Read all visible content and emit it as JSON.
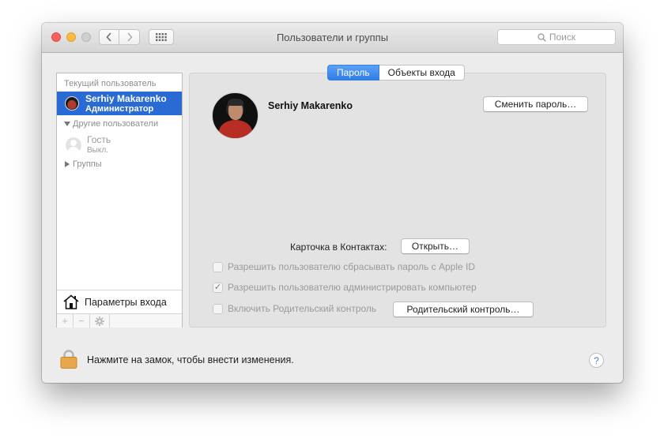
{
  "window": {
    "title": "Пользователи и группы"
  },
  "search": {
    "placeholder": "Поиск"
  },
  "sidebar": {
    "current_user_header": "Текущий пользователь",
    "current_user": {
      "name": "Serhiy Makarenko",
      "role": "Администратор"
    },
    "other_users_header": "Другие пользователи",
    "guest": {
      "name": "Гость",
      "status": "Выкл."
    },
    "groups_label": "Группы",
    "login_options_label": "Параметры входа"
  },
  "tabs": [
    {
      "label": "Пароль",
      "active": true
    },
    {
      "label": "Объекты входа",
      "active": false
    }
  ],
  "panel": {
    "user_name": "Serhiy Makarenko",
    "change_password_button": "Сменить пароль…",
    "contacts_card_label": "Карточка в Контактах:",
    "open_button": "Открыть…",
    "options": [
      {
        "label": "Разрешить пользователю сбрасывать пароль с Apple ID",
        "checked": false
      },
      {
        "label": "Разрешить пользователю администрировать компьютер",
        "checked": true
      },
      {
        "label": "Включить Родительский контроль",
        "checked": false
      }
    ],
    "parental_controls_button": "Родительский контроль…"
  },
  "footer": {
    "lock_text": "Нажмите на замок, чтобы внести изменения.",
    "help_label": "?"
  },
  "colors": {
    "selection": "#2a6ad4",
    "tab_active": "#3b85ef",
    "window_bg": "#ececec"
  }
}
